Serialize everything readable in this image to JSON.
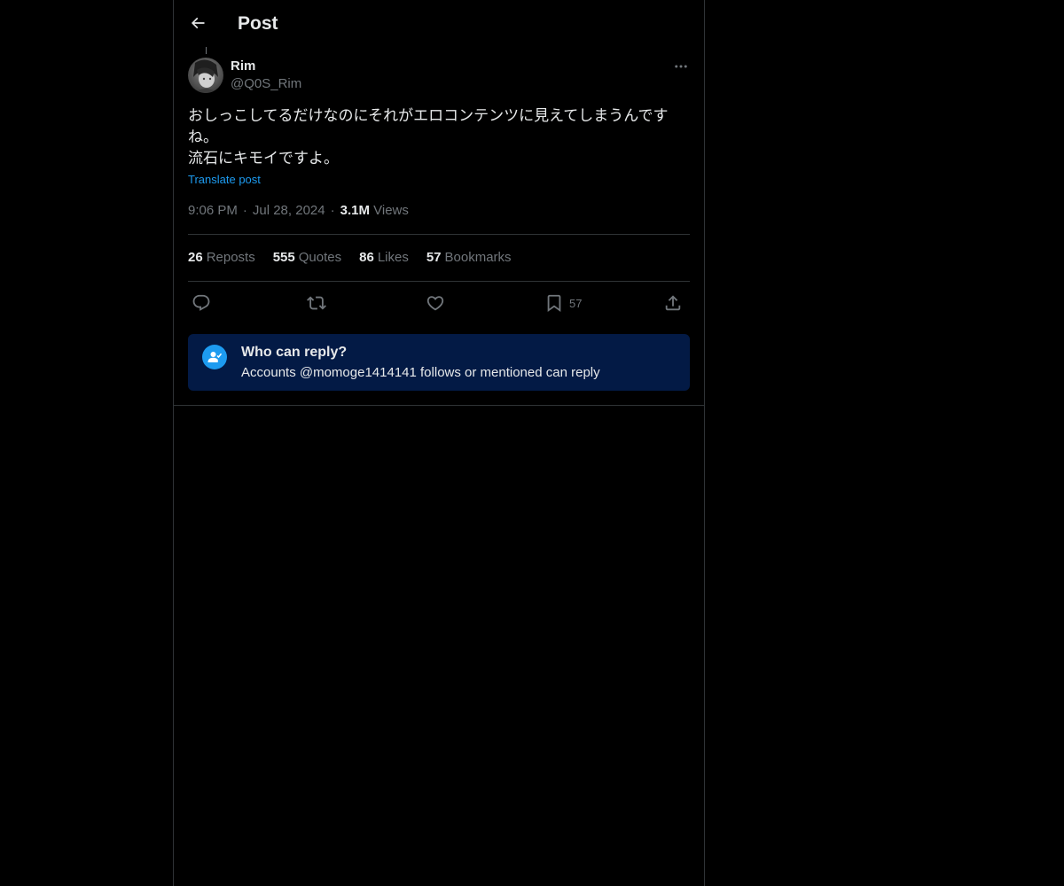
{
  "header": {
    "title": "Post",
    "back_icon": "arrow-left-icon"
  },
  "post": {
    "author": {
      "display_name": "Rim",
      "handle": "@Q0S_Rim"
    },
    "text": "おしっこしてるだけなのにそれがエロコンテンツに見えてしまうんです\nね。\n流石にキモイですよ。",
    "translate_label": "Translate post",
    "time": "9:06 PM",
    "date": "Jul 28, 2024",
    "separator": "·",
    "views_count": "3.1M",
    "views_label": "Views"
  },
  "stats": {
    "reposts": {
      "count": "26",
      "label": "Reposts"
    },
    "quotes": {
      "count": "555",
      "label": "Quotes"
    },
    "likes": {
      "count": "86",
      "label": "Likes"
    },
    "bookmarks": {
      "count": "57",
      "label": "Bookmarks"
    }
  },
  "actions": {
    "reply_icon": "reply-icon",
    "repost_icon": "repost-icon",
    "like_icon": "heart-icon",
    "bookmark_icon": "bookmark-icon",
    "bookmark_count": "57",
    "share_icon": "share-icon"
  },
  "reply_restriction": {
    "title": "Who can reply?",
    "description": "Accounts @momoge1414141 follows or mentioned can reply"
  },
  "colors": {
    "background": "#000000",
    "text_primary": "#e7e9ea",
    "text_secondary": "#71767b",
    "accent": "#1d9bf0",
    "border": "#2f3336",
    "reply_box_bg": "#031a45"
  }
}
